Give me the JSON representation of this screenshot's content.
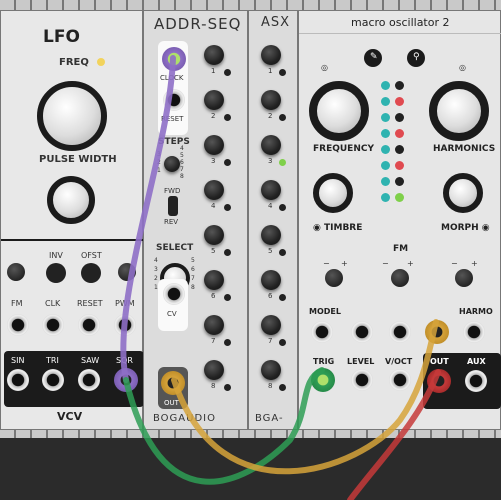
{
  "colors": {
    "cable_purple": "#8e6fc6",
    "cable_green": "#2e9e55",
    "cable_orange": "#d6a33a",
    "cable_red": "#c63a3a",
    "led_yellow": "#f2d35c",
    "led_green": "#7fd04a"
  },
  "lfo": {
    "title": "LFO",
    "freq": "FREQ",
    "pulse_width": "PULSE WIDTH",
    "inv": "INV",
    "ofst": "OFST",
    "fm": "FM",
    "clk": "CLK",
    "reset": "RESET",
    "pwm": "PWM",
    "sin": "SIN",
    "tri": "TRI",
    "saw": "SAW",
    "sqr": "SQR",
    "brand": "VCV"
  },
  "seq": {
    "title": "ADDR-SEQ",
    "clock": "CLOCK",
    "reset": "RESET",
    "steps": "STEPS",
    "fwd": "FWD",
    "rev": "REV",
    "select": "SELECT",
    "cv": "CV",
    "out": "OUT",
    "brand": "BOGAUDIO",
    "step_labels": [
      "1",
      "2",
      "3",
      "4",
      "5",
      "6",
      "7",
      "8"
    ],
    "dial_steps_left": [
      "3",
      "2",
      "1"
    ],
    "dial_steps_right": [
      "4",
      "5",
      "6",
      "7",
      "8"
    ],
    "dial_select_left": [
      "4",
      "3",
      "2",
      "1"
    ],
    "dial_select_right": [
      "5",
      "6",
      "7",
      "8"
    ]
  },
  "asx": {
    "title": "ASX",
    "brand": "BGA-"
  },
  "macro": {
    "title": "macro oscillator 2",
    "frequency": "FREQUENCY",
    "harmonics": "HARMONICS",
    "timbre": "TIMBRE",
    "morph": "MORPH",
    "fm": "FM",
    "model": "MODEL",
    "harmo": "HARMO",
    "trig": "TRIG",
    "level": "LEVEL",
    "voct": "V/OCT",
    "out": "OUT",
    "aux": "AUX",
    "minus": "−",
    "plus": "+"
  }
}
